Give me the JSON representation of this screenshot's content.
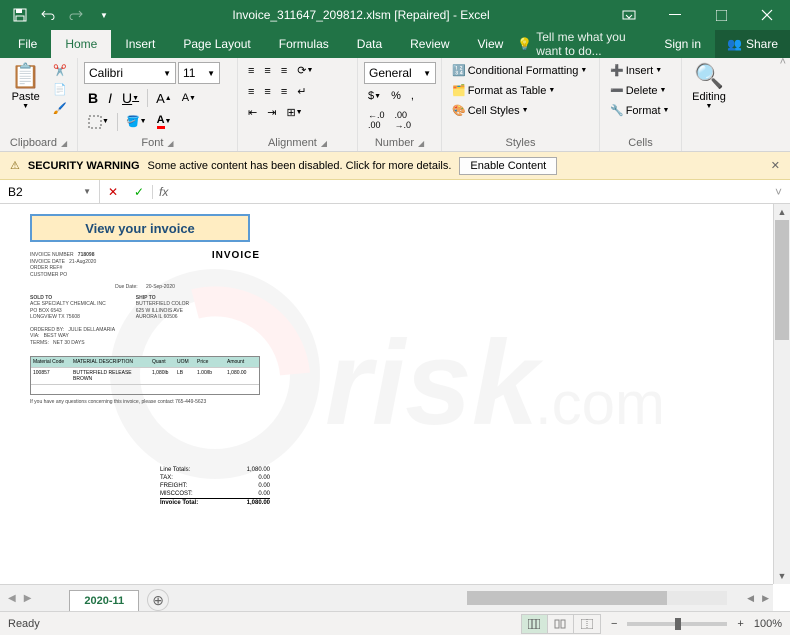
{
  "titlebar": {
    "title": "Invoice_311647_209812.xlsm [Repaired] - Excel"
  },
  "menu": {
    "file": "File",
    "home": "Home",
    "insert": "Insert",
    "pagelayout": "Page Layout",
    "formulas": "Formulas",
    "data": "Data",
    "review": "Review",
    "view": "View",
    "tellme": "Tell me what you want to do...",
    "signin": "Sign in",
    "share": "Share"
  },
  "ribbon": {
    "clipboard": {
      "label": "Clipboard",
      "paste": "Paste"
    },
    "font": {
      "label": "Font",
      "family": "Calibri",
      "size": "11",
      "bold": "B",
      "italic": "I",
      "underline": "U"
    },
    "alignment": {
      "label": "Alignment"
    },
    "number": {
      "label": "Number",
      "format": "General"
    },
    "styles": {
      "label": "Styles",
      "cond": "Conditional Formatting",
      "table": "Format as Table",
      "cell": "Cell Styles"
    },
    "cells": {
      "label": "Cells",
      "insert": "Insert",
      "delete": "Delete",
      "format": "Format"
    },
    "editing": {
      "label": "Editing"
    }
  },
  "msgbar": {
    "label": "SECURITY WARNING",
    "text": "Some active content has been disabled. Click for more details.",
    "enable": "Enable Content"
  },
  "fxbar": {
    "cellref": "B2",
    "fx": "fx"
  },
  "sheet": {
    "button": "View your invoice",
    "invoice_title": "INVOICE",
    "tab": "2020-11"
  },
  "invoice": {
    "num_lbl": "INVOICE NUMBER",
    "num": "718098",
    "date_lbl": "INVOICE DATE",
    "date": "21-Aug2020",
    "ref_lbl": "ORDER REF#",
    "cust_lbl": "CUSTOMER PO",
    "due_lbl": "Due Date:",
    "due": "20-Sep-2020",
    "sold": "SOLD TO",
    "ship": "SHIP TO",
    "tbl_h1": "Material Code",
    "tbl_h2": "MATERIAL DESCRIPTION",
    "totals": {
      "line": "Line Totals:",
      "line_v": "1,080.00",
      "tax": "TAX:",
      "tax_v": "0.00",
      "freight": "FREIGHT:",
      "freight_v": "0.00",
      "misc": "MISCCOST:",
      "misc_v": "0.00",
      "inv": "Invoice Total:",
      "inv_v": "1,080.00"
    },
    "footer": "If you have any questions concerning this invoice, please contact 765-449-5623"
  },
  "status": {
    "ready": "Ready",
    "zoom": "100%"
  }
}
